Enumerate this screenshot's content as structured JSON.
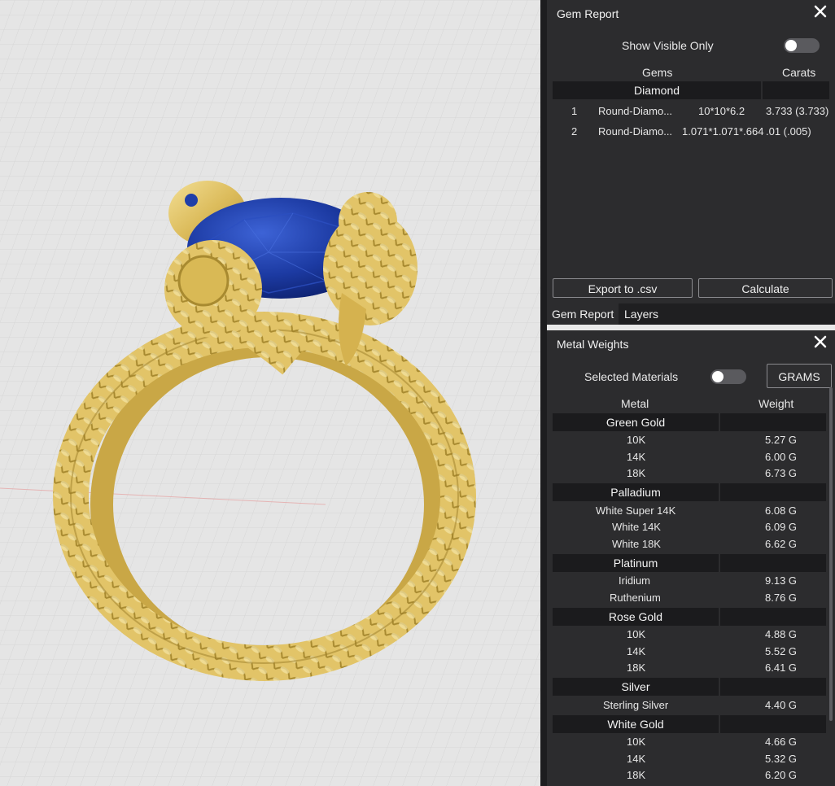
{
  "gem_report": {
    "title": "Gem Report",
    "show_visible_label": "Show Visible Only",
    "col_gems": "Gems",
    "col_carats": "Carats",
    "group": "Diamond",
    "rows": [
      {
        "num": "1",
        "name": "Round-Diamo...",
        "dims": "10*10*6.2",
        "carats": "3.733 (3.733)"
      },
      {
        "num": "2",
        "name": "Round-Diamo...",
        "dims": "1.071*1.071*.664",
        "carats": ".01 (.005)"
      }
    ],
    "export_label": "Export to .csv",
    "calculate_label": "Calculate"
  },
  "tabs": {
    "gem_report": "Gem Report",
    "layers": "Layers"
  },
  "metal_weights": {
    "title": "Metal Weights",
    "selected_label": "Selected Materials",
    "units_label": "GRAMS",
    "col_metal": "Metal",
    "col_weight": "Weight",
    "groups": [
      {
        "name": "Green Gold",
        "items": [
          {
            "metal": "10K",
            "weight": "5.27 G"
          },
          {
            "metal": "14K",
            "weight": "6.00 G"
          },
          {
            "metal": "18K",
            "weight": "6.73 G"
          }
        ]
      },
      {
        "name": "Palladium",
        "items": [
          {
            "metal": "White Super 14K",
            "weight": "6.08 G"
          },
          {
            "metal": "White 14K",
            "weight": "6.09 G"
          },
          {
            "metal": "White 18K",
            "weight": "6.62 G"
          }
        ]
      },
      {
        "name": "Platinum",
        "items": [
          {
            "metal": "Iridium",
            "weight": "9.13 G"
          },
          {
            "metal": "Ruthenium",
            "weight": "8.76 G"
          }
        ]
      },
      {
        "name": "Rose Gold",
        "items": [
          {
            "metal": "10K",
            "weight": "4.88 G"
          },
          {
            "metal": "14K",
            "weight": "5.52 G"
          },
          {
            "metal": "18K",
            "weight": "6.41 G"
          }
        ]
      },
      {
        "name": "Silver",
        "items": [
          {
            "metal": "Sterling Silver",
            "weight": "4.40 G"
          }
        ]
      },
      {
        "name": "White Gold",
        "items": [
          {
            "metal": "10K",
            "weight": "4.66 G"
          },
          {
            "metal": "14K",
            "weight": "5.32 G"
          },
          {
            "metal": "18K",
            "weight": "6.20 G"
          }
        ]
      }
    ]
  },
  "colors": {
    "gold": "#e3c56b",
    "sapphire": "#1f3ea8",
    "panel": "#2c2c2e",
    "header_row": "#1b1b1d"
  }
}
